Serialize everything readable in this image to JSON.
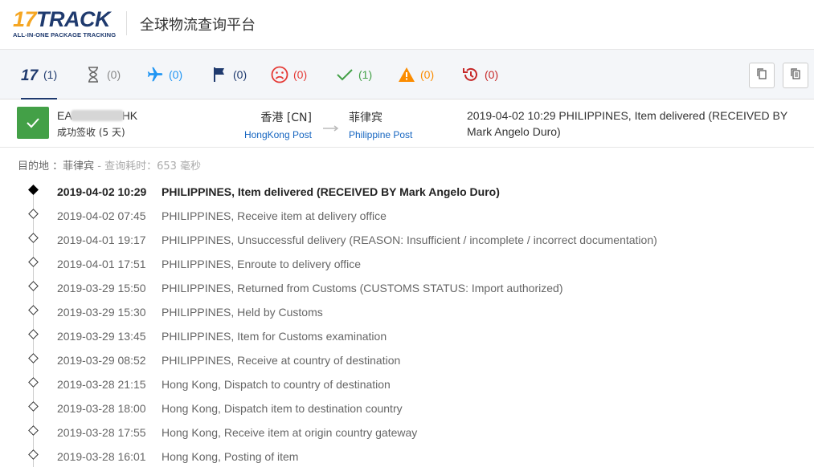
{
  "header": {
    "logo_num": "17",
    "logo_word": "TRACK",
    "logo_tagline": "ALL-IN-ONE PACKAGE TRACKING",
    "title": "全球物流查询平台"
  },
  "tabs": [
    {
      "name": "all",
      "count": "(1)",
      "color": "#1f3a6e"
    },
    {
      "name": "pending",
      "count": "(0)",
      "color": "#666666"
    },
    {
      "name": "in-transit",
      "count": "(0)",
      "color": "#2196f3"
    },
    {
      "name": "pickup",
      "count": "(0)",
      "color": "#1f3a6e"
    },
    {
      "name": "undelivered",
      "count": "(0)",
      "color": "#e53935"
    },
    {
      "name": "delivered",
      "count": "(1)",
      "color": "#43a047"
    },
    {
      "name": "alert",
      "count": "(0)",
      "color": "#fb8c00"
    },
    {
      "name": "expired",
      "count": "(0)",
      "color": "#c62828"
    }
  ],
  "summary": {
    "tracking_prefix": "EA",
    "tracking_suffix": "HK",
    "status": "成功签收 (5 天)",
    "origin_country": "香港 [CN]",
    "origin_carrier": "HongKong Post",
    "dest_country": "菲律宾",
    "dest_carrier": "Philippine Post",
    "latest_event": "2019-04-02 10:29  PHILIPPINES, Item delivered (RECEIVED BY Mark Angelo Duro)"
  },
  "destination_info": {
    "label": "目的地 ：菲律宾",
    "meta": " - 查询耗时：653 毫秒"
  },
  "events": [
    {
      "time": "2019-04-02 10:29",
      "desc": "PHILIPPINES, Item delivered (RECEIVED BY Mark Angelo Duro)"
    },
    {
      "time": "2019-04-02 07:45",
      "desc": "PHILIPPINES, Receive item at delivery office"
    },
    {
      "time": "2019-04-01 19:17",
      "desc": "PHILIPPINES, Unsuccessful delivery (REASON: Insufficient / incomplete / incorrect documentation)"
    },
    {
      "time": "2019-04-01 17:51",
      "desc": "PHILIPPINES, Enroute to delivery office"
    },
    {
      "time": "2019-03-29 15:50",
      "desc": "PHILIPPINES, Returned from Customs (CUSTOMS STATUS: Import authorized)"
    },
    {
      "time": "2019-03-29 15:30",
      "desc": "PHILIPPINES, Held by Customs"
    },
    {
      "time": "2019-03-29 13:45",
      "desc": "PHILIPPINES, Item for Customs examination"
    },
    {
      "time": "2019-03-29 08:52",
      "desc": "PHILIPPINES, Receive at country of destination"
    },
    {
      "time": "2019-03-28 21:15",
      "desc": "Hong Kong, Dispatch to country of destination"
    },
    {
      "time": "2019-03-28 18:00",
      "desc": "Hong Kong, Dispatch item to destination country"
    },
    {
      "time": "2019-03-28 17:55",
      "desc": "Hong Kong, Receive item at origin country gateway"
    },
    {
      "time": "2019-03-28 16:01",
      "desc": "Hong Kong, Posting of item"
    }
  ]
}
